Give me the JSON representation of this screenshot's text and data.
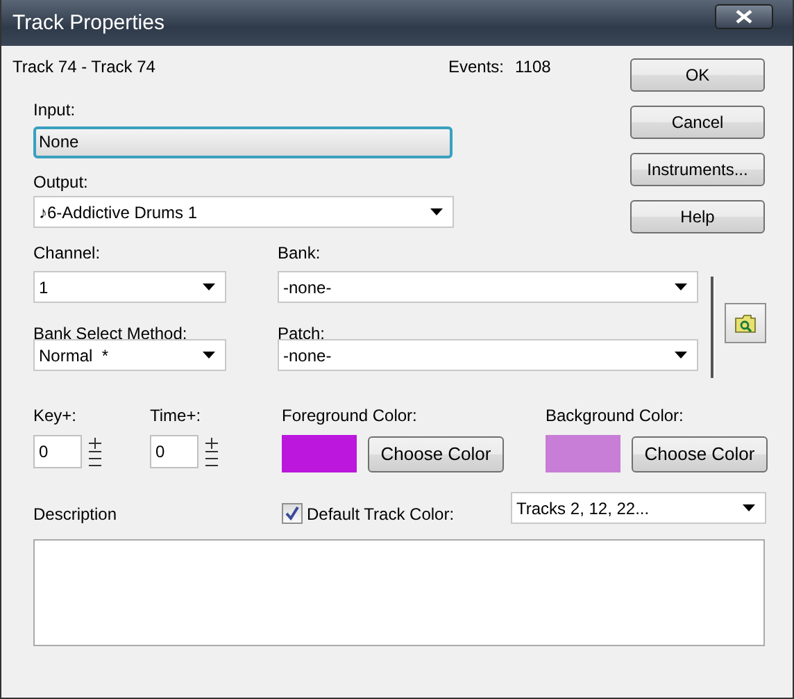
{
  "window": {
    "title": "Track Properties"
  },
  "header": {
    "track": "Track 74 - Track 74",
    "events_label": "Events:",
    "events": "1108"
  },
  "input": {
    "label": "Input:",
    "value": "None"
  },
  "output": {
    "label": "Output:",
    "value": "♪6-Addictive Drums 1"
  },
  "buttons": [
    "OK",
    "Cancel",
    "Instruments...",
    "Help"
  ],
  "channel": {
    "label": "Channel:",
    "value": "1"
  },
  "bank": {
    "label": "Bank:",
    "value": "-none-"
  },
  "bank_select_method": {
    "label": "Bank Select Method:",
    "value": "Normal  *"
  },
  "patch": {
    "label": "Patch:",
    "value": "-none-"
  },
  "key": {
    "label": "Key+:",
    "value": "0"
  },
  "time": {
    "label": "Time+:",
    "value": "0"
  },
  "colors": [
    {
      "label": "Foreground Color:",
      "color": "#bb17dd",
      "button": "Choose Color"
    },
    {
      "label": "Background Color:",
      "color": "#c87dd6",
      "button": "Choose Color"
    }
  ],
  "description": {
    "label": "Description"
  },
  "default_track_color": {
    "label": "Default Track Color:",
    "checked": true,
    "value": "Tracks 2, 12, 22..."
  }
}
